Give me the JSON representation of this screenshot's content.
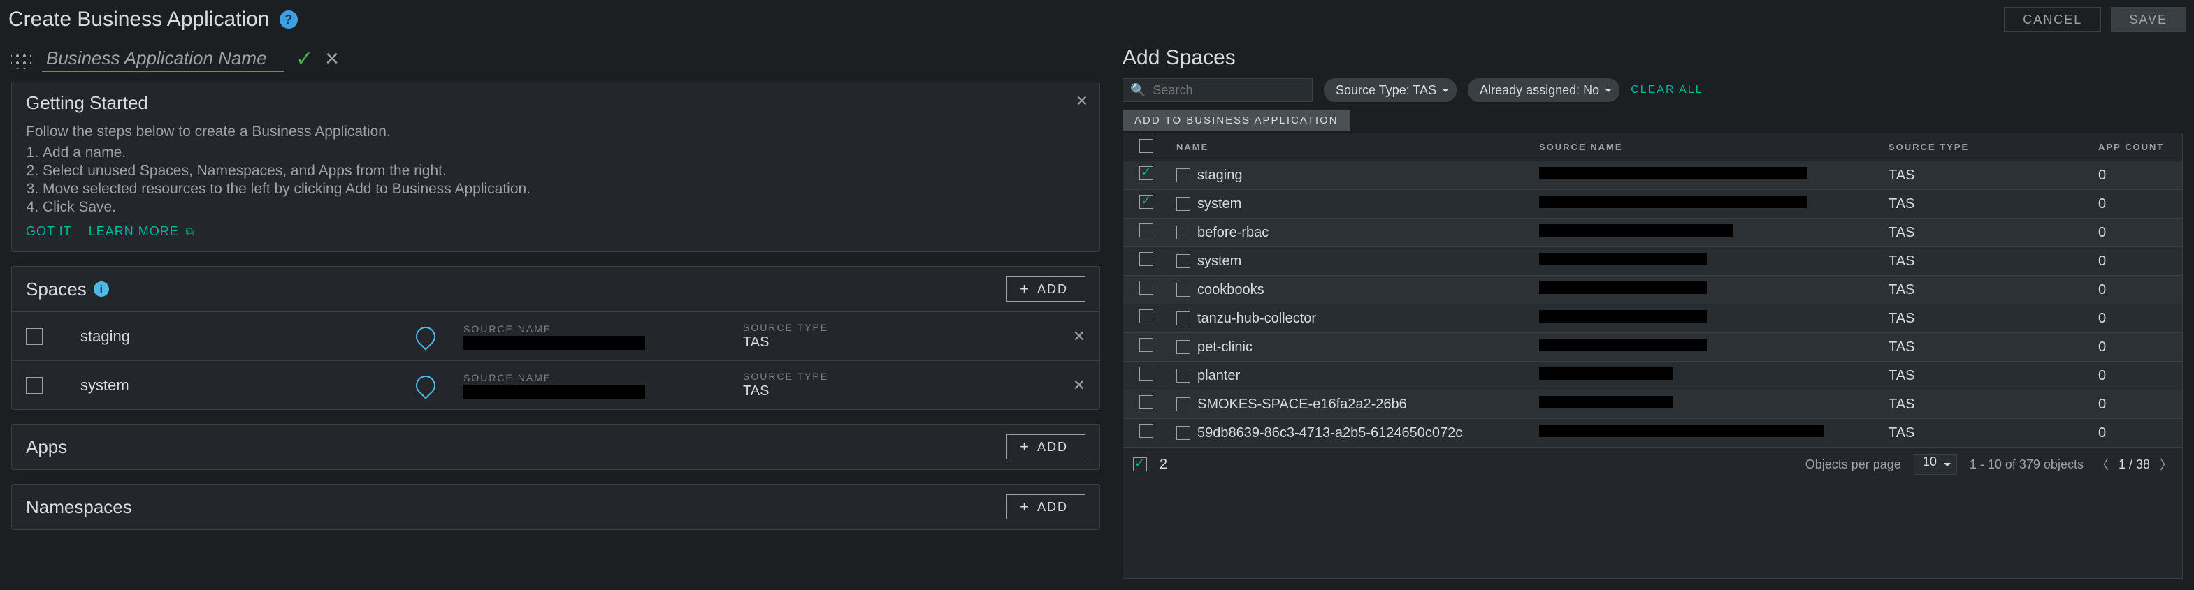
{
  "header": {
    "title": "Create Business Application",
    "cancel": "CANCEL",
    "save": "SAVE"
  },
  "name_input": {
    "placeholder": "Business Application Name",
    "value": ""
  },
  "getting_started": {
    "title": "Getting Started",
    "intro": "Follow the steps below to create a Business Application.",
    "steps": [
      "Add a name.",
      "Select unused Spaces, Namespaces, and Apps from the right.",
      "Move selected resources to the left by clicking Add to Business Application.",
      "Click Save."
    ],
    "got_it": "GOT IT",
    "learn_more": "LEARN MORE"
  },
  "sections": {
    "spaces": {
      "title": "Spaces",
      "add_label": "ADD"
    },
    "apps": {
      "title": "Apps",
      "add_label": "ADD"
    },
    "ns": {
      "title": "Namespaces",
      "add_label": "ADD"
    }
  },
  "space_items": [
    {
      "name": "staging",
      "source_name_label": "SOURCE NAME",
      "source_name": "",
      "source_type_label": "SOURCE TYPE",
      "source_type": "TAS"
    },
    {
      "name": "system",
      "source_name_label": "SOURCE NAME",
      "source_name": "",
      "source_type_label": "SOURCE TYPE",
      "source_type": "TAS"
    }
  ],
  "right": {
    "title": "Add Spaces",
    "search_placeholder": "Search",
    "chip_source_type": "Source Type: TAS",
    "chip_assigned": "Already assigned: No",
    "clear_all": "CLEAR ALL",
    "add_to_ba": "ADD TO BUSINESS APPLICATION",
    "columns": {
      "name": "NAME",
      "source_name": "SOURCE NAME",
      "source_type": "SOURCE TYPE",
      "app_count": "APP COUNT"
    },
    "rows": [
      {
        "checked": true,
        "name": "staging",
        "source_type": "TAS",
        "app_count": "0",
        "snw": "w80"
      },
      {
        "checked": true,
        "name": "system",
        "source_type": "TAS",
        "app_count": "0",
        "snw": "w80"
      },
      {
        "checked": false,
        "name": "before-rbac",
        "source_type": "TAS",
        "app_count": "0",
        "snw": "w58"
      },
      {
        "checked": false,
        "name": "system",
        "source_type": "TAS",
        "app_count": "0",
        "snw": "w50"
      },
      {
        "checked": false,
        "name": "cookbooks",
        "source_type": "TAS",
        "app_count": "0",
        "snw": "w50"
      },
      {
        "checked": false,
        "name": "tanzu-hub-collector",
        "source_type": "TAS",
        "app_count": "0",
        "snw": "w50"
      },
      {
        "checked": false,
        "name": "pet-clinic",
        "source_type": "TAS",
        "app_count": "0",
        "snw": "w50"
      },
      {
        "checked": false,
        "name": "planter",
        "source_type": "TAS",
        "app_count": "0",
        "snw": "w40"
      },
      {
        "checked": false,
        "name": "SMOKES-SPACE-e16fa2a2-26b6",
        "source_type": "TAS",
        "app_count": "0",
        "snw": "w40"
      },
      {
        "checked": false,
        "name": "59db8639-86c3-4713-a2b5-6124650c072c",
        "source_type": "TAS",
        "app_count": "0",
        "snw": "w85"
      }
    ],
    "footer": {
      "selected_count": "2",
      "objects_per_page_label": "Objects per page",
      "page_size": "10",
      "range_text": "1 - 10 of 379 objects",
      "page_text": "1 / 38"
    }
  }
}
